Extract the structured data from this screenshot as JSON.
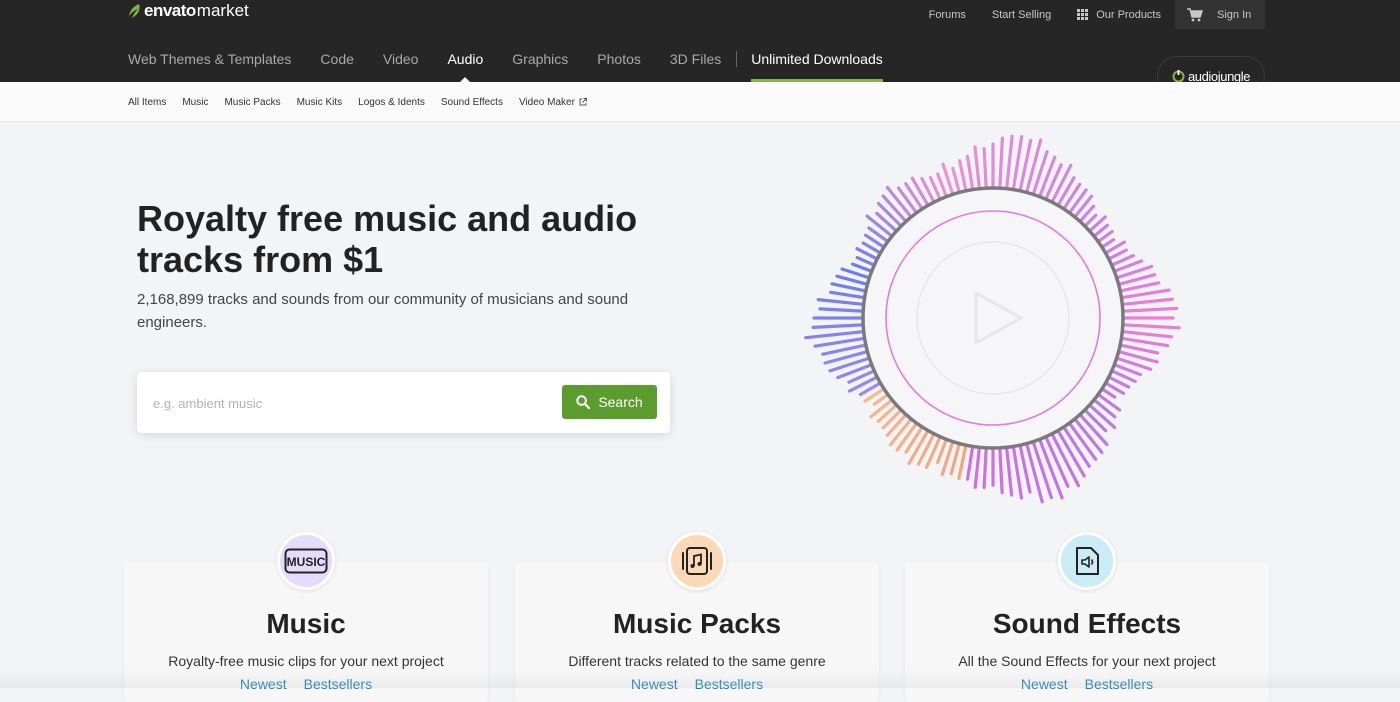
{
  "header": {
    "logo_brand": "envato",
    "logo_suffix": "market",
    "top_links": {
      "forums": "Forums",
      "start_selling": "Start Selling",
      "our_products": "Our Products",
      "sign_in": "Sign In"
    },
    "nav": [
      {
        "label": "Web Themes & Templates",
        "active": false
      },
      {
        "label": "Code",
        "active": false
      },
      {
        "label": "Video",
        "active": false
      },
      {
        "label": "Audio",
        "active": true
      },
      {
        "label": "Graphics",
        "active": false
      },
      {
        "label": "Photos",
        "active": false
      },
      {
        "label": "3D Files",
        "active": false
      }
    ],
    "unlimited": "Unlimited Downloads",
    "site_badge": "audiojungle",
    "accent": "#82b541"
  },
  "subnav": [
    "All Items",
    "Music",
    "Music Packs",
    "Music Kits",
    "Logos & Idents",
    "Sound Effects",
    "Video Maker"
  ],
  "hero": {
    "title": "Royalty free music and audio tracks from $1",
    "subtitle": "2,168,899 tracks and sounds from our community of musicians and sound engineers.",
    "search_placeholder": "e.g. ambient music",
    "search_value": "",
    "search_button": "Search",
    "button_color": "#5c9c2e"
  },
  "cards": [
    {
      "title": "Music",
      "description": "Royalty-free music clips for your next project",
      "link_newest": "Newest",
      "link_bestsellers": "Bestsellers",
      "icon": "music-label-icon",
      "badge_color": "#e4dcfb"
    },
    {
      "title": "Music Packs",
      "description": "Different tracks related to the same genre",
      "link_newest": "Newest",
      "link_bestsellers": "Bestsellers",
      "icon": "music-pack-icon",
      "badge_color": "#fbd8b8"
    },
    {
      "title": "Sound Effects",
      "description": "All the Sound Effects for your next project",
      "link_newest": "Newest",
      "link_bestsellers": "Bestsellers",
      "icon": "sound-file-icon",
      "badge_color": "#c9ecf6"
    }
  ]
}
